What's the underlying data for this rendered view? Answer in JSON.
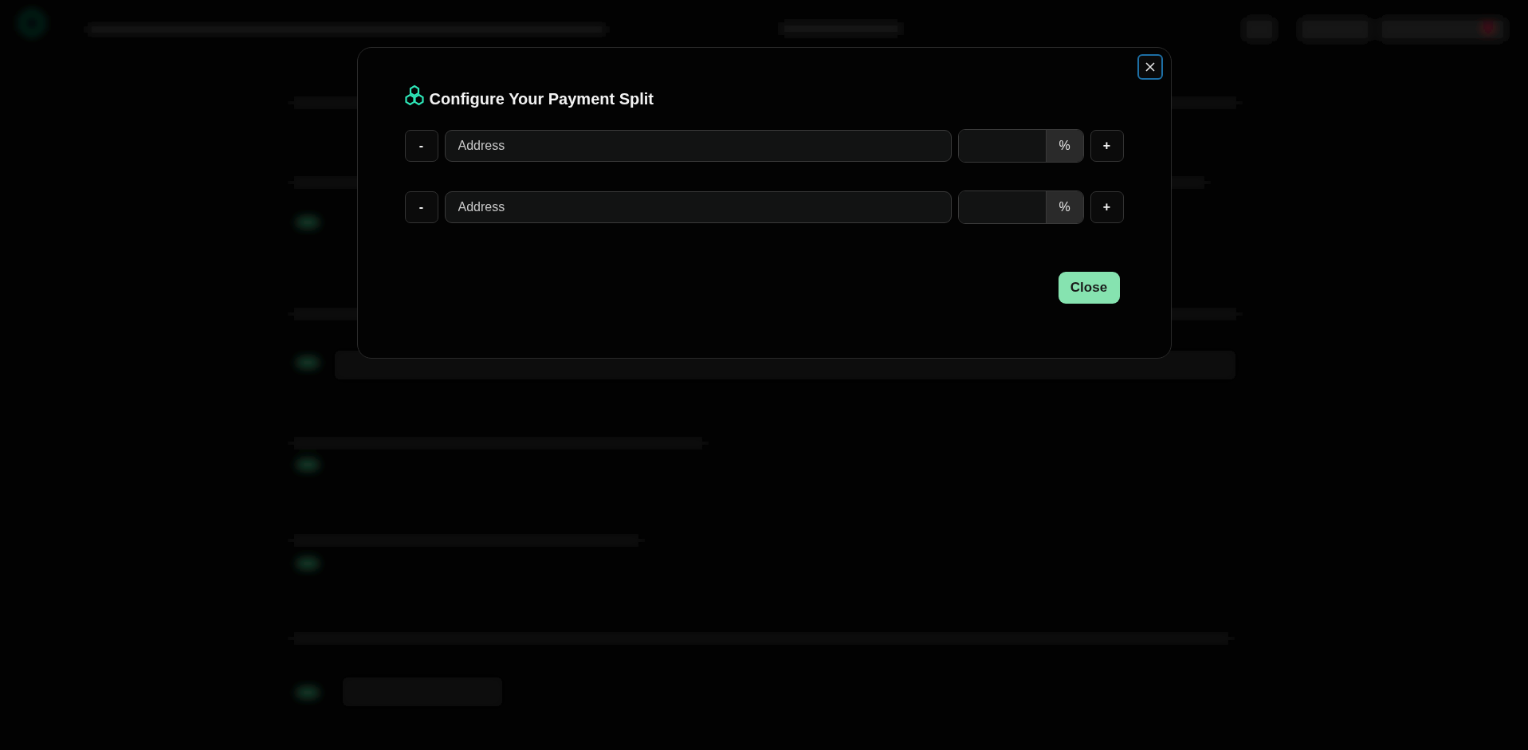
{
  "dialog": {
    "title": "Configure Your Payment Split",
    "rows": [
      {
        "remove_label": "-",
        "address_placeholder": "Address",
        "percent_suffix": "%",
        "add_label": "+"
      },
      {
        "remove_label": "-",
        "address_placeholder": "Address",
        "percent_suffix": "%",
        "add_label": "+"
      }
    ],
    "close_button": "Close"
  }
}
